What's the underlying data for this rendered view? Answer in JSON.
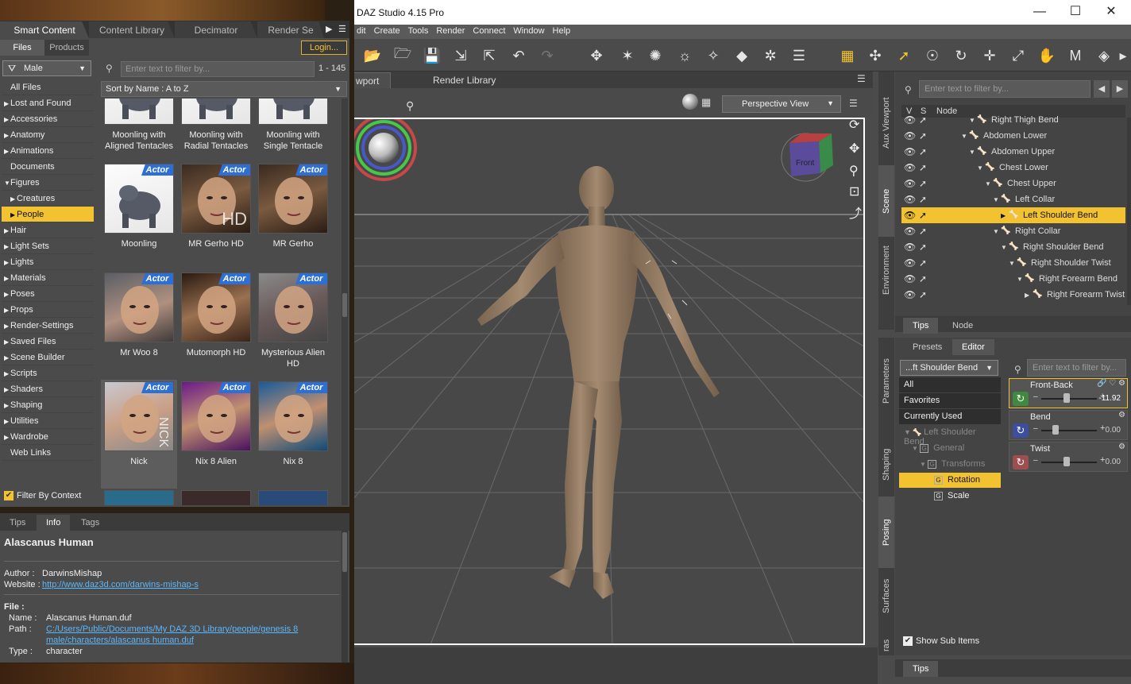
{
  "window": {
    "title": "DAZ Studio 4.15 Pro",
    "min_icon": "minimize-icon",
    "max_icon": "maximize-icon",
    "close_icon": "close-icon"
  },
  "menu": [
    "dit",
    "Create",
    "Tools",
    "Render",
    "Connect",
    "Window",
    "Help"
  ],
  "viewport": {
    "tabs": [
      "wport",
      "Render Library"
    ],
    "camera": "Perspective View",
    "cube_label": "Front"
  },
  "smart_content": {
    "tabs": [
      "Smart Content",
      "Content Library",
      "Decimator",
      "Render Se"
    ],
    "subtabs": [
      "Files",
      "Products"
    ],
    "login": "Login...",
    "gender": "Male",
    "search_placeholder": "Enter text to filter by...",
    "count": "1 - 145",
    "sort": "Sort by Name : A to Z",
    "categories": [
      {
        "label": "All Files",
        "type": "plain"
      },
      {
        "label": "Lost and Found",
        "type": "collapsed"
      },
      {
        "label": "Accessories",
        "type": "collapsed"
      },
      {
        "label": "Anatomy",
        "type": "collapsed"
      },
      {
        "label": "Animations",
        "type": "collapsed"
      },
      {
        "label": "Documents",
        "type": "plain"
      },
      {
        "label": "Figures",
        "type": "expanded"
      },
      {
        "label": "Creatures",
        "type": "sub"
      },
      {
        "label": "People",
        "type": "sub-selected"
      },
      {
        "label": "Hair",
        "type": "collapsed"
      },
      {
        "label": "Light Sets",
        "type": "collapsed"
      },
      {
        "label": "Lights",
        "type": "collapsed"
      },
      {
        "label": "Materials",
        "type": "collapsed"
      },
      {
        "label": "Poses",
        "type": "collapsed"
      },
      {
        "label": "Props",
        "type": "collapsed"
      },
      {
        "label": "Render-Settings",
        "type": "collapsed"
      },
      {
        "label": "Saved Files",
        "type": "collapsed"
      },
      {
        "label": "Scene Builder",
        "type": "collapsed"
      },
      {
        "label": "Scripts",
        "type": "collapsed"
      },
      {
        "label": "Shaders",
        "type": "collapsed"
      },
      {
        "label": "Shaping",
        "type": "collapsed"
      },
      {
        "label": "Utilities",
        "type": "collapsed"
      },
      {
        "label": "Wardrobe",
        "type": "collapsed"
      },
      {
        "label": "Web Links",
        "type": "plain"
      }
    ],
    "filter_by_context": "Filter By Context",
    "badge_text": "Actor",
    "items": [
      {
        "name": "Moonling with\nAligned Tentacles",
        "badge": false,
        "style": "creature"
      },
      {
        "name": "Moonling with\nRadial Tentacles",
        "badge": false,
        "style": "creature"
      },
      {
        "name": "Moonling with\nSingle Tentacle",
        "badge": false,
        "style": "creature-red"
      },
      {
        "name": "Moonling",
        "badge": true,
        "style": "creature"
      },
      {
        "name": "MR Gerho HD",
        "badge": true,
        "style": "man",
        "overlay": "HD"
      },
      {
        "name": "MR Gerho",
        "badge": true,
        "style": "man"
      },
      {
        "name": "Mr Woo 8",
        "badge": true,
        "style": "old"
      },
      {
        "name": "Mutomorph HD",
        "badge": true,
        "style": "monster"
      },
      {
        "name": "Mysterious Alien\nHD",
        "badge": true,
        "style": "alien"
      },
      {
        "name": "Nick",
        "badge": true,
        "style": "young",
        "overlay": "NICK",
        "selected": true
      },
      {
        "name": "Nix 8 Alien",
        "badge": true,
        "style": "purple"
      },
      {
        "name": "Nix 8",
        "badge": true,
        "style": "blue"
      }
    ]
  },
  "info": {
    "tabs": [
      "Tips",
      "Info",
      "Tags"
    ],
    "title": "Alascanus Human",
    "author_label": "Author :",
    "author": "DarwinsMishap",
    "website_label": "Website :",
    "website": "http://www.daz3d.com/darwins-mishap-s",
    "file_label": "File :",
    "name_label": "Name :",
    "name": "Alascanus Human.duf",
    "path_label": "Path :",
    "path1": "C:/Users/Public/Documents/My DAZ 3D Library/people/genesis 8",
    "path2": "male/characters/alascanus human.duf",
    "type_label": "Type :",
    "type": "character"
  },
  "scene": {
    "side_tabs": [
      "Aux Viewport",
      "Scene",
      "Environment"
    ],
    "search_placeholder": "Enter text to filter by...",
    "col_v": "V",
    "col_s": "S",
    "col_node": "Node",
    "rows": [
      {
        "label": "Right Thigh Bend",
        "indent": 3,
        "selected": false
      },
      {
        "label": "Abdomen Lower",
        "indent": 2,
        "selected": false
      },
      {
        "label": "Abdomen Upper",
        "indent": 3,
        "selected": false
      },
      {
        "label": "Chest Lower",
        "indent": 4,
        "selected": false
      },
      {
        "label": "Chest Upper",
        "indent": 5,
        "selected": false
      },
      {
        "label": "Left Collar",
        "indent": 6,
        "selected": false
      },
      {
        "label": "Left Shoulder Bend",
        "indent": 7,
        "selected": true
      },
      {
        "label": "Right Collar",
        "indent": 6,
        "selected": false
      },
      {
        "label": "Right Shoulder Bend",
        "indent": 7,
        "selected": false
      },
      {
        "label": "Right Shoulder Twist",
        "indent": 8,
        "selected": false
      },
      {
        "label": "Right Forearm Bend",
        "indent": 9,
        "selected": false
      },
      {
        "label": "Right Forearm Twist",
        "indent": 10,
        "selected": false
      }
    ],
    "bottom_tabs": [
      "Tips",
      "Node"
    ]
  },
  "params": {
    "side_tabs": [
      "Parameters",
      "Shaping",
      "Posing",
      "Surfaces",
      "ras"
    ],
    "tabs": [
      "Presets",
      "Editor"
    ],
    "node": "...ft Shoulder Bend",
    "search_placeholder": "Enter text to filter by...",
    "list": [
      {
        "label": "All",
        "style": "dark"
      },
      {
        "label": "Favorites",
        "style": "dark"
      },
      {
        "label": "Currently Used",
        "style": "dark"
      },
      {
        "label": "Left Shoulder Bend",
        "style": "grey-node"
      },
      {
        "label": "General",
        "style": "grey-group"
      },
      {
        "label": "Transforms",
        "style": "grey-group2"
      },
      {
        "label": "Rotation",
        "style": "sel"
      },
      {
        "label": "Scale",
        "style": "group"
      }
    ],
    "props": [
      {
        "name": "Front-Back",
        "value": "-11.92",
        "fraction": 0.4,
        "color": "#3f8a3f",
        "selected": true
      },
      {
        "name": "Bend",
        "value": "0.00",
        "fraction": 0.2,
        "color": "#3e4e9e",
        "selected": false
      },
      {
        "name": "Twist",
        "value": "0.00",
        "fraction": 0.4,
        "color": "#9e4e4e",
        "selected": false
      }
    ],
    "show_sub_items": "Show Sub Items",
    "bottom_tab": "Tips"
  }
}
